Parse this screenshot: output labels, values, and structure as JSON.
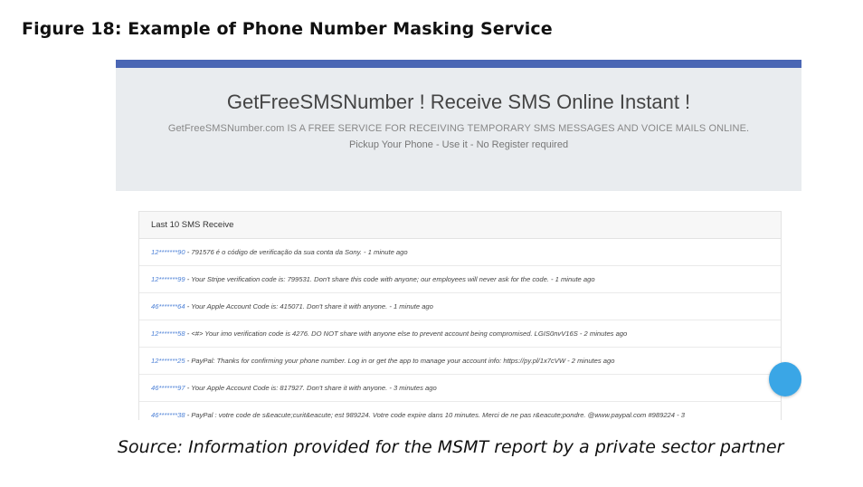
{
  "figure_title": "Figure 18: Example of Phone Number Masking Service",
  "site": {
    "title": "GetFreeSMSNumber ! Receive SMS Online Instant !",
    "description": "GetFreeSMSNumber.com IS A FREE SERVICE FOR RECEIVING TEMPORARY SMS MESSAGES AND VOICE MAILS ONLINE.",
    "subtitle": "Pickup Your Phone - Use it - No Register required"
  },
  "sms_list": {
    "header": "Last 10 SMS Receive",
    "rows": [
      {
        "number": "12*******90",
        "text": " - 791576 é o código de verificação da sua conta da Sony. - 1 minute ago"
      },
      {
        "number": "12*******99",
        "text": " - Your Stripe verification code is: 799531. Don't share this code with anyone; our employees will never ask for the code. - 1 minute ago"
      },
      {
        "number": "46*******64",
        "text": " - Your Apple Account Code is: 415071. Don't share it with anyone. - 1 minute ago"
      },
      {
        "number": "12*******58",
        "text": " - <#> Your imo verification code is 4276. DO NOT share with anyone else to prevent account being compromised. LGIS0nvV16S - 2 minutes ago"
      },
      {
        "number": "12*******25",
        "text": " - PayPal: Thanks for confirming your phone number. Log in or get the app to manage your account info: https://py.pl/1x7cVW - 2 minutes ago"
      },
      {
        "number": "46*******97",
        "text": " - Your Apple Account Code is: 817927. Don't share it with anyone. - 3 minutes ago"
      },
      {
        "number": "46*******38",
        "text": " - PayPal : votre code de s&eacute;curit&eacute; est 989224. Votre code expire dans 10 minutes. Merci de ne pas r&eacute;pondre. @www.paypal.com #989224 - 3"
      }
    ]
  },
  "source": "Source: Information provided for the MSMT report by a private sector partner"
}
